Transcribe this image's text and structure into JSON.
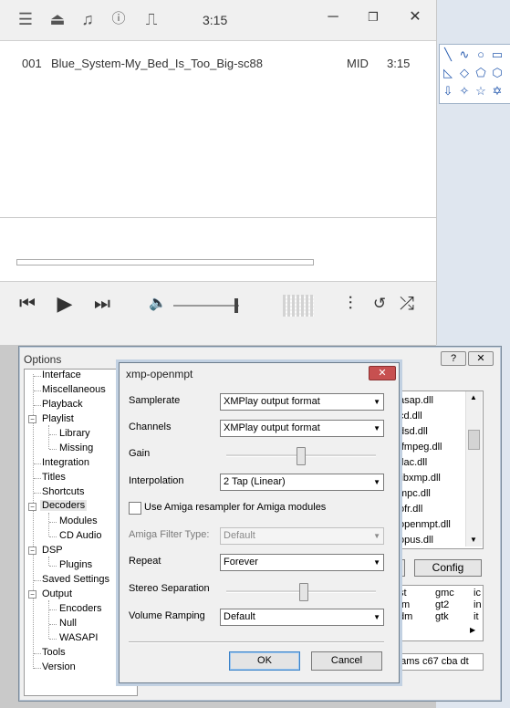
{
  "player": {
    "time": "3:15",
    "playlist": [
      {
        "index": "001",
        "title": "Blue_System-My_Bed_Is_Too_Big-sc88",
        "format": "MID",
        "length": "3:15"
      }
    ],
    "volume_level": 0.95
  },
  "options_window": {
    "title": "Options",
    "tree": [
      {
        "label": "Interface"
      },
      {
        "label": "Miscellaneous"
      },
      {
        "label": "Playback"
      },
      {
        "label": "Playlist"
      },
      {
        "label": "Library"
      },
      {
        "label": "Missing"
      },
      {
        "label": "Integration"
      },
      {
        "label": "Titles"
      },
      {
        "label": "Shortcuts"
      },
      {
        "label": "Decoders"
      },
      {
        "label": "Modules"
      },
      {
        "label": "CD Audio"
      },
      {
        "label": "DSP"
      },
      {
        "label": "Plugins"
      },
      {
        "label": "Saved Settings"
      },
      {
        "label": "Output"
      },
      {
        "label": "Encoders"
      },
      {
        "label": "Null"
      },
      {
        "label": "WASAPI"
      },
      {
        "label": "Tools"
      },
      {
        "label": "Version"
      }
    ],
    "dlls": [
      "asap.dll",
      "cd.dll",
      "dsd.dll",
      "ffmpeg.dll",
      "flac.dll",
      "libxmp.dll",
      "mpc.dll",
      "ofr.dll",
      "openmpt.dll",
      "opus.dll"
    ],
    "config_label": "Config",
    "extensions": [
      [
        "st",
        "gmc",
        "ic"
      ],
      [
        "tm",
        "gt2",
        "in"
      ],
      [
        "dm",
        "gtk",
        "it"
      ]
    ],
    "ext_row": "f  ams  c67  cba  dt"
  },
  "dialog": {
    "title": "xmp-openmpt",
    "close_label": "✕",
    "samplerate_label": "Samplerate",
    "samplerate_value": "XMPlay output format",
    "channels_label": "Channels",
    "channels_value": "XMPlay output format",
    "gain_label": "Gain",
    "gain_level": 0.5,
    "interpolation_label": "Interpolation",
    "interpolation_value": "2 Tap (Linear)",
    "amiga_resampler_label": "Use Amiga resampler for Amiga modules",
    "amiga_resampler_checked": false,
    "amiga_filter_label": "Amiga Filter Type:",
    "amiga_filter_value": "Default",
    "repeat_label": "Repeat",
    "repeat_value": "Forever",
    "stereo_label": "Stereo Separation",
    "stereo_level": 0.52,
    "volume_ramping_label": "Volume Ramping",
    "volume_ramping_value": "Default",
    "ok_label": "OK",
    "cancel_label": "Cancel"
  }
}
